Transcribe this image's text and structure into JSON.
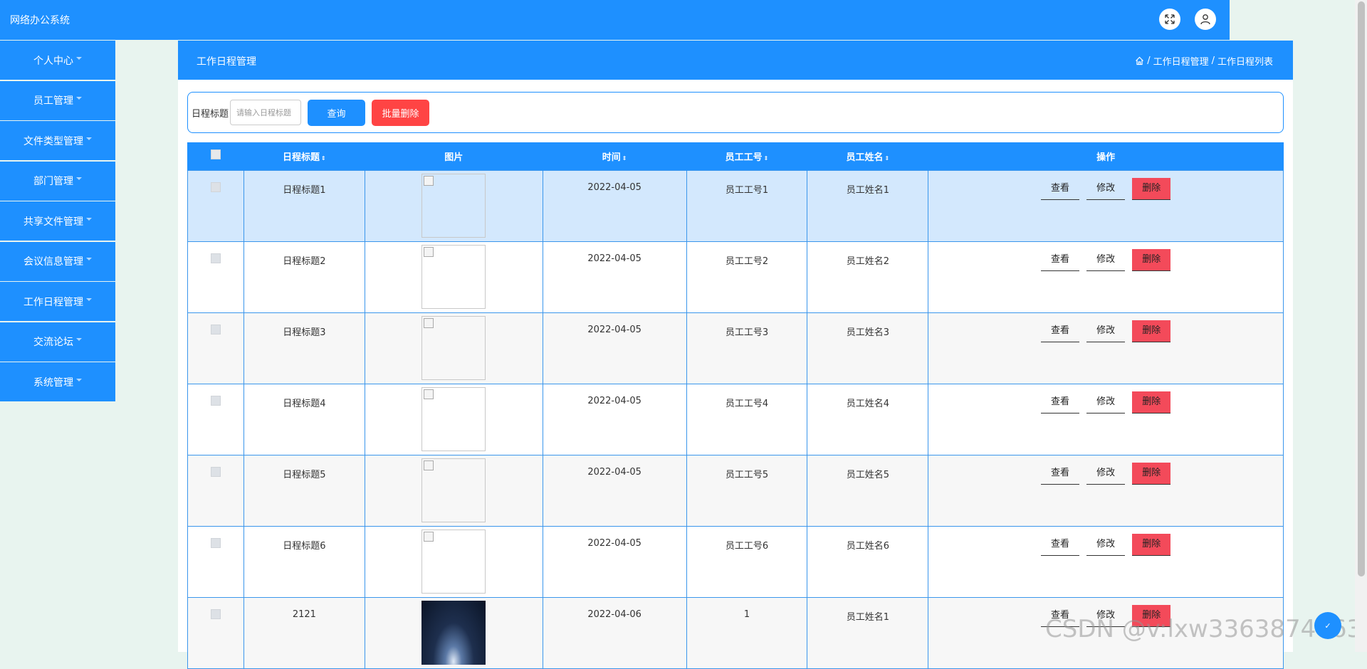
{
  "app": {
    "title": "网络办公系统"
  },
  "header_icons": {
    "fullscreen": "expand-icon",
    "user": "user-icon"
  },
  "sidebar": {
    "items": [
      {
        "label": "个人中心"
      },
      {
        "label": "员工管理"
      },
      {
        "label": "文件类型管理"
      },
      {
        "label": "部门管理"
      },
      {
        "label": "共享文件管理"
      },
      {
        "label": "会议信息管理"
      },
      {
        "label": "工作日程管理"
      },
      {
        "label": "交流论坛"
      },
      {
        "label": "系统管理"
      }
    ]
  },
  "main": {
    "title": "工作日程管理",
    "breadcrumb": {
      "home_icon": "home-icon",
      "sep": "/",
      "level1": "工作日程管理",
      "level2": "工作日程列表"
    }
  },
  "search": {
    "label": "日程标题",
    "placeholder": "请输入日程标题",
    "query_label": "查询",
    "batch_delete_label": "批量删除"
  },
  "table": {
    "headers": {
      "title": "日程标题",
      "image": "图片",
      "time": "时间",
      "emp_no": "员工工号",
      "emp_name": "员工姓名",
      "ops": "操作"
    },
    "sort_glyph": "⇕",
    "rows": [
      {
        "title": "日程标题1",
        "time": "2022-04-05",
        "emp_no": "员工工号1",
        "emp_name": "员工姓名1"
      },
      {
        "title": "日程标题2",
        "time": "2022-04-05",
        "emp_no": "员工工号2",
        "emp_name": "员工姓名2"
      },
      {
        "title": "日程标题3",
        "time": "2022-04-05",
        "emp_no": "员工工号3",
        "emp_name": "员工姓名3"
      },
      {
        "title": "日程标题4",
        "time": "2022-04-05",
        "emp_no": "员工工号4",
        "emp_name": "员工姓名4"
      },
      {
        "title": "日程标题5",
        "time": "2022-04-05",
        "emp_no": "员工工号5",
        "emp_name": "员工姓名5"
      },
      {
        "title": "日程标题6",
        "time": "2022-04-05",
        "emp_no": "员工工号6",
        "emp_name": "员工姓名6"
      },
      {
        "title": "2121",
        "time": "2022-04-06",
        "emp_no": "1",
        "emp_name": "员工姓名1"
      }
    ],
    "actions": {
      "view": "查看",
      "edit": "修改",
      "delete": "删除"
    }
  },
  "watermark": "CSDN @v:lxw3363874663",
  "float_button": "✓",
  "colors": {
    "primary": "#1e90ff",
    "danger": "#f44",
    "row_selected": "#d3e8fd",
    "page_bg": "#e8f4ef"
  }
}
